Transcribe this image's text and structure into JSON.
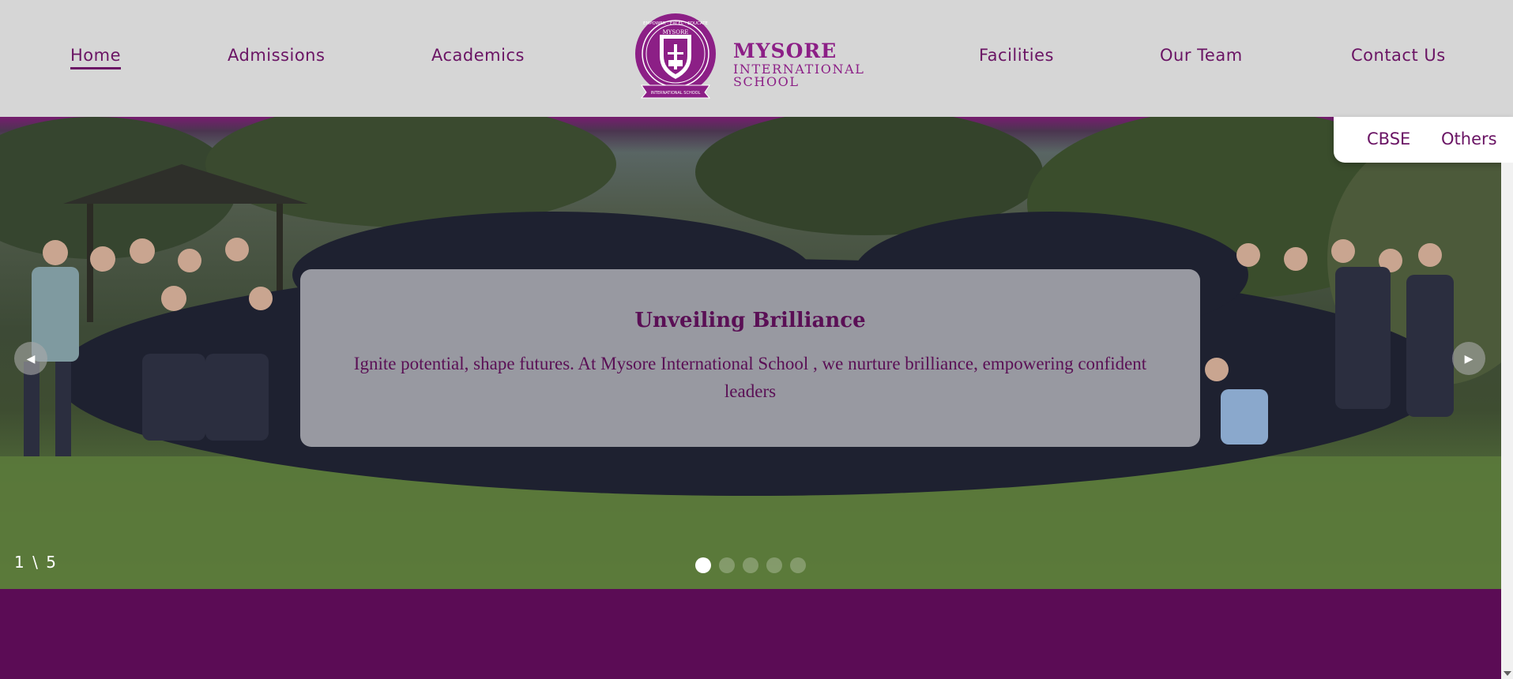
{
  "nav": {
    "left": [
      "Home",
      "Admissions",
      "Academics"
    ],
    "right": [
      "Facilities",
      "Our Team",
      "Contact Us"
    ],
    "active": "Home"
  },
  "logo": {
    "line1": "MYSORE",
    "line2": "INTERNATIONAL",
    "line3": "SCHOOL",
    "seal_arc": "EMPOWER · EXCEL · EDUCATE",
    "seal_center": "MYSORE",
    "seal_ribbon": "INTERNATIONAL SCHOOL"
  },
  "subnav": [
    "CBSE",
    "Others"
  ],
  "hero": {
    "title": "Unveiling Brilliance",
    "text": "Ignite potential, shape futures. At Mysore International School , we nurture brilliance, empowering confident leaders",
    "counter_current": "1",
    "counter_sep": "\\",
    "counter_total": "5",
    "slide_count": 5,
    "active_slide": 1
  },
  "colors": {
    "brand": "#6a1464",
    "header_bg": "#d6d6d6",
    "footer_bg": "#5b0c55"
  }
}
